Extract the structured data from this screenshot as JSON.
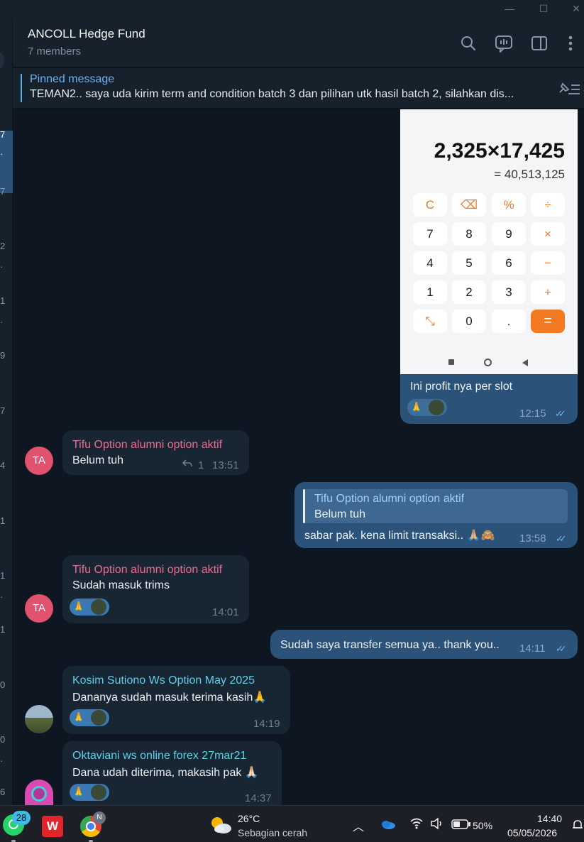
{
  "window": {
    "minimize": "—",
    "maximize": "☐",
    "close": "✕"
  },
  "sidebar": {
    "unread_numbers": [
      "7",
      "·",
      "7",
      "2",
      "·",
      "1",
      "·",
      "9",
      "7",
      "4",
      "1",
      "1",
      "·",
      "1",
      "0",
      "0",
      "·",
      "6"
    ]
  },
  "header": {
    "title": "ANCOLL Hedge Fund",
    "subtitle": "7 members",
    "icons": [
      "search-icon",
      "live-chat-icon",
      "sidebar-toggle-icon",
      "more-icon"
    ]
  },
  "pinned": {
    "title": "Pinned message",
    "text": "TEMAN2.. saya uda kirim term and condition batch 3 dan pilihan utk hasil batch 2, silahkan dis..."
  },
  "calculator": {
    "expression": "2,325×17,425",
    "result": "= 40,513,125",
    "keys": [
      [
        "C",
        "⌫",
        "%",
        "÷"
      ],
      [
        "7",
        "8",
        "9",
        "×"
      ],
      [
        "4",
        "5",
        "6",
        "−"
      ],
      [
        "1",
        "2",
        "3",
        "+"
      ],
      [
        "⤡",
        "0",
        ".",
        "="
      ]
    ]
  },
  "messages": [
    {
      "type": "out",
      "text": "Ini profit nya per slot",
      "time": "12:15",
      "reaction": "🙏"
    },
    {
      "type": "in",
      "avatar": "TA",
      "sender": "Tifu Option alumni option aktif",
      "text": "Belum tuh",
      "replies": "1",
      "time": "13:51"
    },
    {
      "type": "out",
      "quote_sender": "Tifu Option alumni option aktif",
      "quote_text": "Belum tuh",
      "text": "sabar pak. kena limit transaksi.. 🙏🏼🙈",
      "time": "13:58"
    },
    {
      "type": "in",
      "avatar": "TA",
      "sender": "Tifu Option alumni option aktif",
      "text": "Sudah masuk   trims",
      "time": "14:01",
      "reaction": "🙏"
    },
    {
      "type": "out",
      "text": "Sudah saya transfer semua ya.. thank you..",
      "time": "14:11"
    },
    {
      "type": "in",
      "sender": "Kosim Sutiono Ws Option May 2025",
      "text": "Dananya sudah masuk terima kasih🙏",
      "time": "14:19",
      "reaction": "🙏"
    },
    {
      "type": "in",
      "sender": "Oktaviani ws online forex 27mar21",
      "text": "Dana udah diterima, makasih pak 🙏🏻",
      "time": "14:37",
      "reaction": "🙏"
    }
  ],
  "taskbar": {
    "whatsapp_badge": "28",
    "chrome_badge": "N",
    "weather_temp": "26°C",
    "weather_desc": "Sebagian cerah",
    "battery": "50%",
    "time": "14:40",
    "date": "05/05/2026"
  },
  "colors": {
    "sender_pink": "#ee6b8b",
    "sender_cyan": "#5fd0e8",
    "accent": "#6ab3f3"
  }
}
